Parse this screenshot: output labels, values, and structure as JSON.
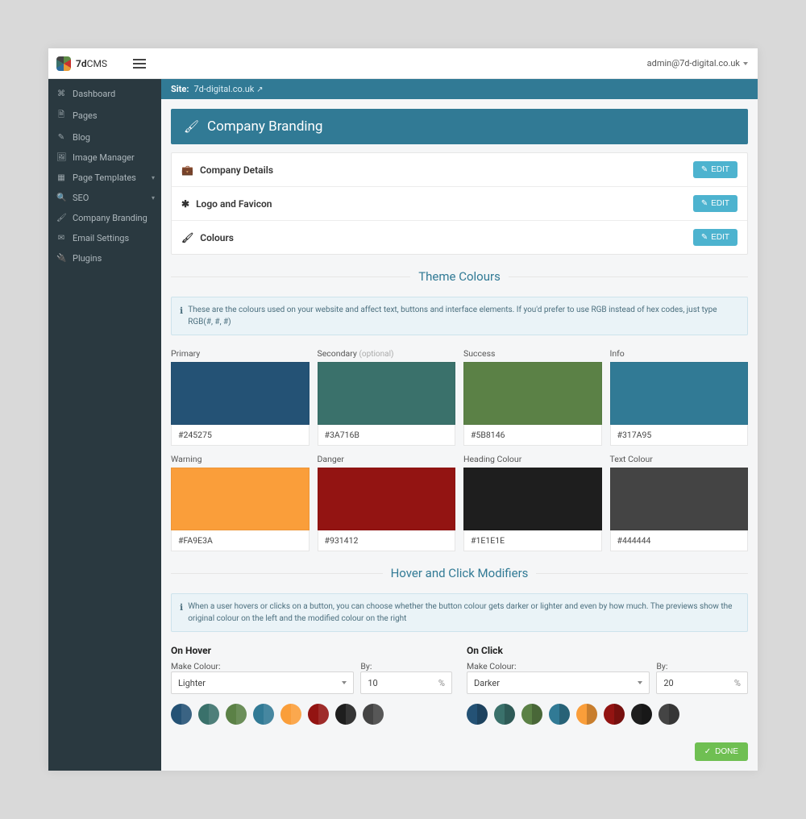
{
  "brand": {
    "name_a": "7d",
    "name_b": "CMS"
  },
  "user": {
    "email": "admin@7d-digital.co.uk"
  },
  "site": {
    "label": "Site:",
    "domain": "7d-digital.co.uk"
  },
  "sidebar": {
    "items": [
      {
        "icon": "dashboard",
        "label": "Dashboard",
        "expandable": false
      },
      {
        "icon": "file",
        "label": "Pages",
        "expandable": false
      },
      {
        "icon": "pencil",
        "label": "Blog",
        "expandable": false
      },
      {
        "icon": "image",
        "label": "Image Manager",
        "expandable": false
      },
      {
        "icon": "layout",
        "label": "Page Templates",
        "expandable": true
      },
      {
        "icon": "search",
        "label": "SEO",
        "expandable": true
      },
      {
        "icon": "brush",
        "label": "Company Branding",
        "expandable": false
      },
      {
        "icon": "mail",
        "label": "Email Settings",
        "expandable": false
      },
      {
        "icon": "plug",
        "label": "Plugins",
        "expandable": false
      }
    ]
  },
  "page": {
    "title": "Company Branding",
    "sections": {
      "company_details": "Company Details",
      "logo_favicon": "Logo and Favicon",
      "colours": "Colours"
    },
    "edit_label": "EDIT"
  },
  "theme_colours": {
    "heading": "Theme Colours",
    "info": "These are the colours used on your website and affect text, buttons and interface elements. If you'd prefer to use RGB instead of hex codes, just type RGB(#, #, #)",
    "swatches": [
      {
        "label": "Primary",
        "optional": false,
        "hex": "#245275"
      },
      {
        "label": "Secondary",
        "optional": true,
        "hex": "#3A716B"
      },
      {
        "label": "Success",
        "optional": false,
        "hex": "#5B8146"
      },
      {
        "label": "Info",
        "optional": false,
        "hex": "#317A95"
      },
      {
        "label": "Warning",
        "optional": false,
        "hex": "#FA9E3A"
      },
      {
        "label": "Danger",
        "optional": false,
        "hex": "#931412"
      },
      {
        "label": "Heading Colour",
        "optional": false,
        "hex": "#1E1E1E"
      },
      {
        "label": "Text Colour",
        "optional": false,
        "hex": "#444444"
      }
    ]
  },
  "modifiers": {
    "heading": "Hover and Click Modifiers",
    "info": "When a user hovers or clicks on a button, you can choose whether the button colour gets darker or lighter and even by how much. The previews show the original colour on the left and the modified colour on the right",
    "hover": {
      "title": "On Hover",
      "make_label": "Make Colour:",
      "by_label": "By:",
      "make_value": "Lighter",
      "by_value": "10",
      "unit": "%"
    },
    "click": {
      "title": "On Click",
      "make_label": "Make Colour:",
      "by_label": "By:",
      "make_value": "Darker",
      "by_value": "20",
      "unit": "%"
    }
  },
  "done_label": "DONE",
  "optional_text": "(optional)",
  "icons": {
    "dashboard": "⌘",
    "file": "🗎",
    "pencil": "✎",
    "image": "🖼",
    "layout": "▦",
    "search": "🔍",
    "brush": "🖌",
    "mail": "✉",
    "plug": "🔌",
    "briefcase": "💼",
    "asterisk": "✱",
    "info": "ℹ",
    "check": "✓",
    "external": "↗"
  }
}
